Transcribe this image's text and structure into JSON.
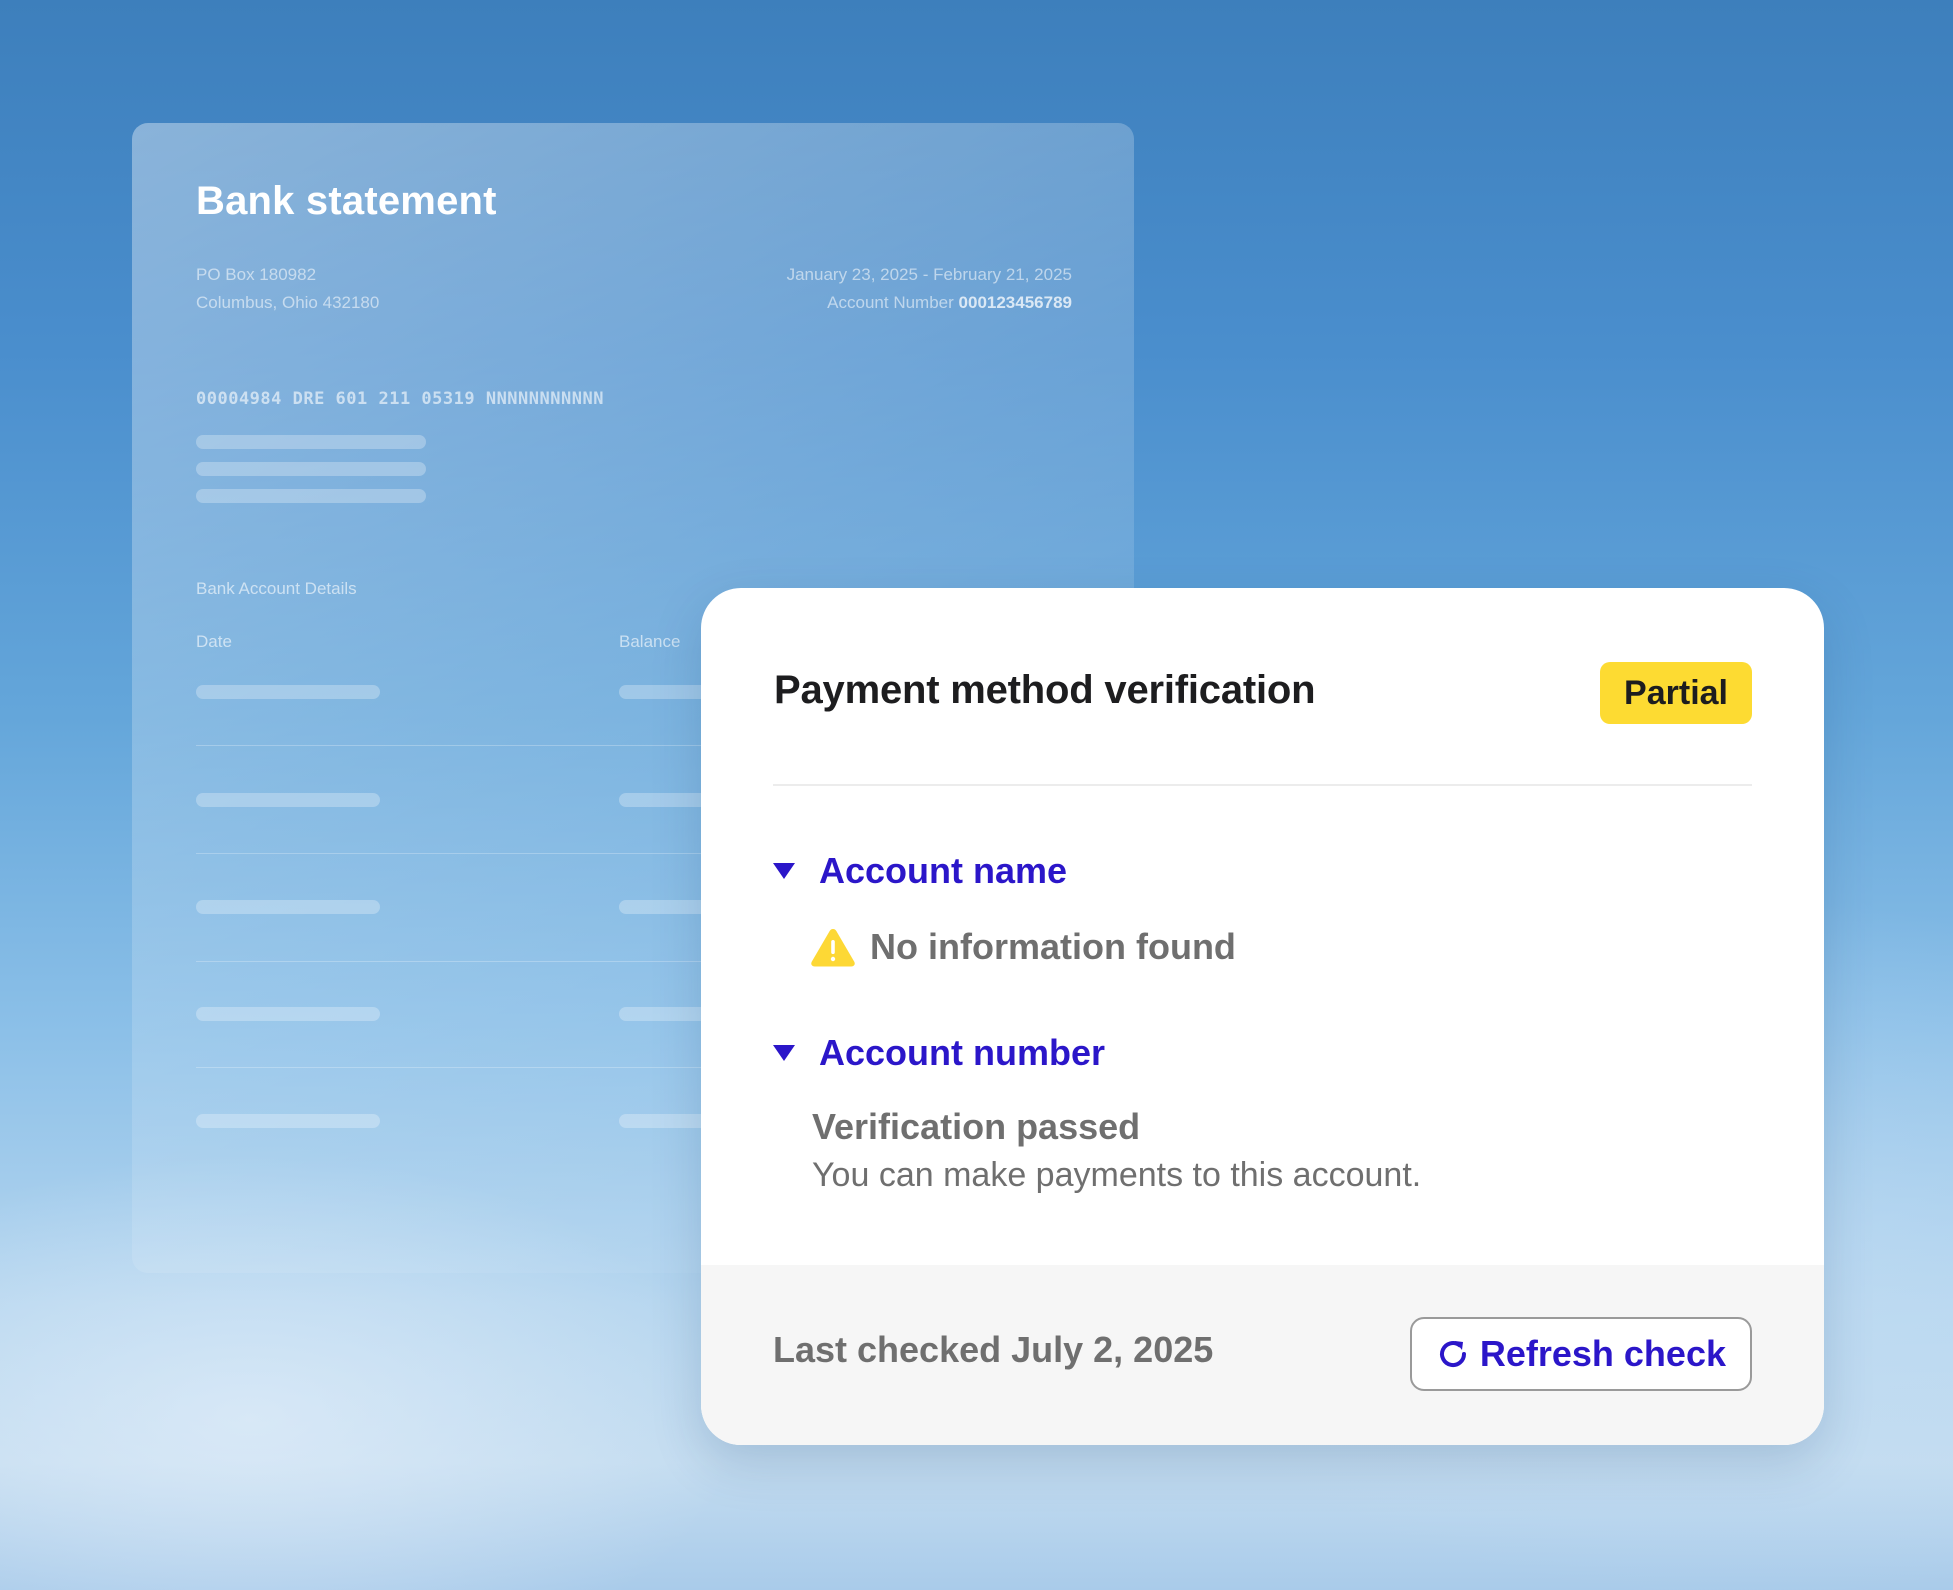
{
  "statement": {
    "title": "Bank statement",
    "address_line1": "PO Box 180982",
    "address_line2": "Columbus, Ohio 432180",
    "date_range": "January 23, 2025 - February 21, 2025",
    "account_number_label": "Account Number",
    "account_number": "000123456789",
    "reference_code": "00004984 DRE 601 211 05319 NNNNNNNNNNN",
    "details_label": "Bank Account Details",
    "col_date": "Date",
    "col_balance": "Balance"
  },
  "verification": {
    "title": "Payment method verification",
    "status_badge": "Partial",
    "status_color": "#fddb32",
    "accent_color": "#2b16c9",
    "sections": [
      {
        "label": "Account name",
        "icon": "warning-icon",
        "message": "No information found"
      },
      {
        "label": "Account number",
        "result_title": "Verification passed",
        "result_description": "You can make payments to this account."
      }
    ],
    "last_checked": "Last checked July 2, 2025",
    "refresh_label": "Refresh check",
    "refresh_icon": "refresh-icon"
  }
}
